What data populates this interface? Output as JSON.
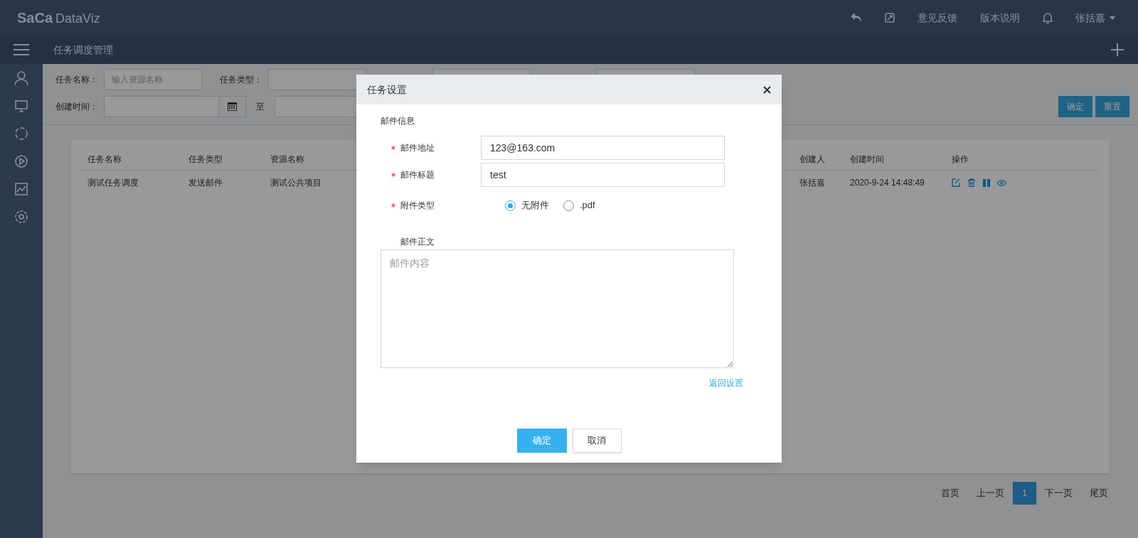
{
  "header": {
    "logo": "SaCa",
    "product": "DataViz",
    "links": [
      "意见反馈",
      "版本说明"
    ],
    "user": "张括嘉"
  },
  "breadcrumb": "任务调度管理",
  "filters": [
    {
      "kind": "text",
      "label": "任务名称：",
      "placeholder": "输入资源名称"
    },
    {
      "kind": "select",
      "label": "任务类型："
    },
    {
      "kind": "select"
    },
    {
      "kind": "select"
    },
    {
      "kind": "date",
      "label": "创建时间：",
      "separator": "至"
    }
  ],
  "filter_buttons": [
    "确定",
    "重置"
  ],
  "table": {
    "columns": [
      "任务名称",
      "任务类型",
      "资源名称",
      "创建人",
      "创建时间",
      "操作"
    ],
    "rows": [
      {
        "cells": [
          "测试任务调度",
          "发送邮件",
          "测试公共项目",
          "张括嘉",
          "2020-9-24 14:48:49"
        ]
      }
    ]
  },
  "pagination": [
    {
      "label": "首页",
      "selected": false
    },
    {
      "label": "上一页",
      "selected": false
    },
    {
      "label": "1",
      "selected": true
    },
    {
      "label": "下一页",
      "selected": false
    },
    {
      "label": "尾页",
      "selected": false
    }
  ],
  "dialog": {
    "title": "任务设置",
    "section": "邮件信息",
    "fields": [
      {
        "kind": "input",
        "label": "邮件地址",
        "required": true,
        "value": "123@163.com"
      },
      {
        "kind": "input",
        "label": "邮件标题",
        "required": true,
        "value": "test"
      },
      {
        "kind": "radio",
        "label": "附件类型",
        "required": true,
        "options": [
          {
            "label": "无附件",
            "selected": true
          },
          {
            "label": ".pdf",
            "selected": false
          }
        ]
      }
    ],
    "body": {
      "label": "邮件正文",
      "placeholder": "邮件内容"
    },
    "link": "返回设置",
    "buttons": [
      {
        "label": "确定",
        "kind": "primary"
      },
      {
        "label": "取消",
        "kind": "default"
      }
    ]
  }
}
